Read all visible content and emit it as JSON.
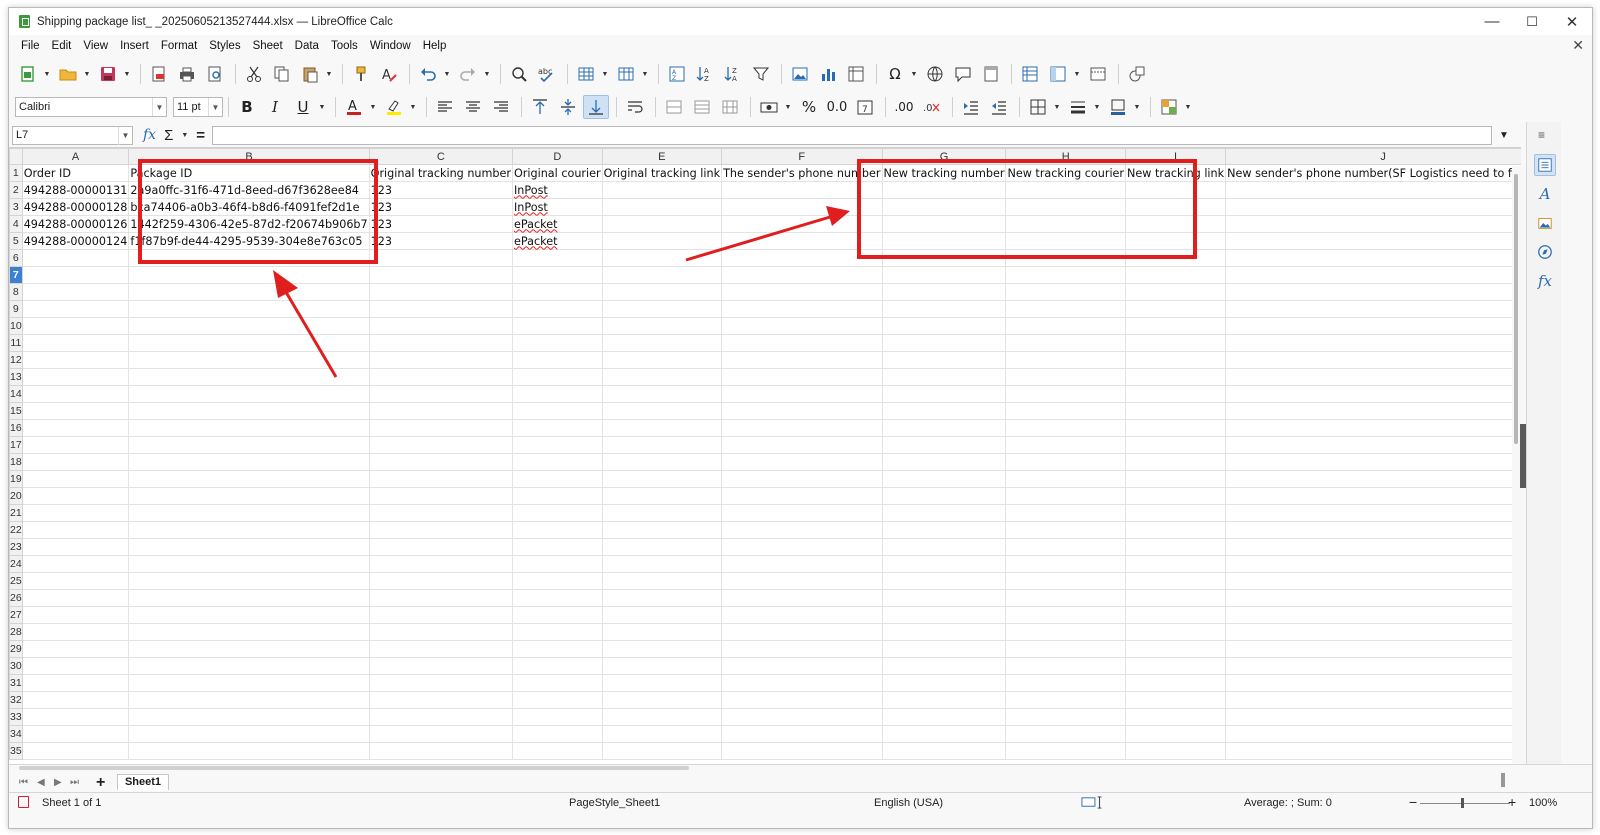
{
  "window": {
    "title": "Shipping package list_        _20250605213527444.xlsx — LibreOffice Calc",
    "minimize": "—",
    "maximize": "☐",
    "close": "✕"
  },
  "menu": [
    "File",
    "Edit",
    "View",
    "Insert",
    "Format",
    "Styles",
    "Sheet",
    "Data",
    "Tools",
    "Window",
    "Help"
  ],
  "formatting": {
    "font_name": "Calibri",
    "font_size": "11 pt"
  },
  "formula_bar": {
    "cell_ref": "L7",
    "fx": "fx",
    "sigma": "Σ",
    "equals": "=",
    "content": ""
  },
  "columns": [
    "A",
    "B",
    "C",
    "D",
    "E",
    "F",
    "G",
    "H",
    "I",
    "J"
  ],
  "rows": [
    [
      "Order ID",
      "Package ID",
      "Original tracking number",
      "Original courier",
      "Original tracking link",
      "The sender's phone number",
      "New tracking number",
      "New tracking courier",
      "New tracking link",
      "New sender's phone number(SF Logistics need to fill in)"
    ],
    [
      "494288-00000131",
      "2a9a0ffc-31f6-471d-8eed-d67f3628ee84",
      "123",
      "InPost",
      "",
      "",
      "",
      "",
      "",
      ""
    ],
    [
      "494288-00000128",
      "bca74406-a0b3-46f4-b8d6-f4091fef2d1e",
      "123",
      "InPost",
      "",
      "",
      "",
      "",
      "",
      ""
    ],
    [
      "494288-00000126",
      "1442f259-4306-42e5-87d2-f20674b906b7",
      "123",
      "ePacket",
      "",
      "",
      "",
      "",
      "",
      ""
    ],
    [
      "494288-00000124",
      "f1f87b9f-de44-4295-9539-304e8e763c05",
      "123",
      "ePacket",
      "",
      "",
      "",
      "",
      "",
      ""
    ]
  ],
  "row_count": 35,
  "selected_row": 7,
  "sheet_tabs": {
    "add": "+",
    "active": "Sheet1"
  },
  "status": {
    "sheet": "Sheet 1 of 1",
    "page_style": "PageStyle_Sheet1",
    "language": "English (USA)",
    "summary": "Average: ; Sum: 0",
    "zoom": "100%",
    "zoom_minus": "−",
    "zoom_plus": "+"
  },
  "colors": {
    "annotation_red": "#e01e1e",
    "selected_row_header": "#3d7fd1",
    "accent_blue": "#2b6cb0"
  }
}
